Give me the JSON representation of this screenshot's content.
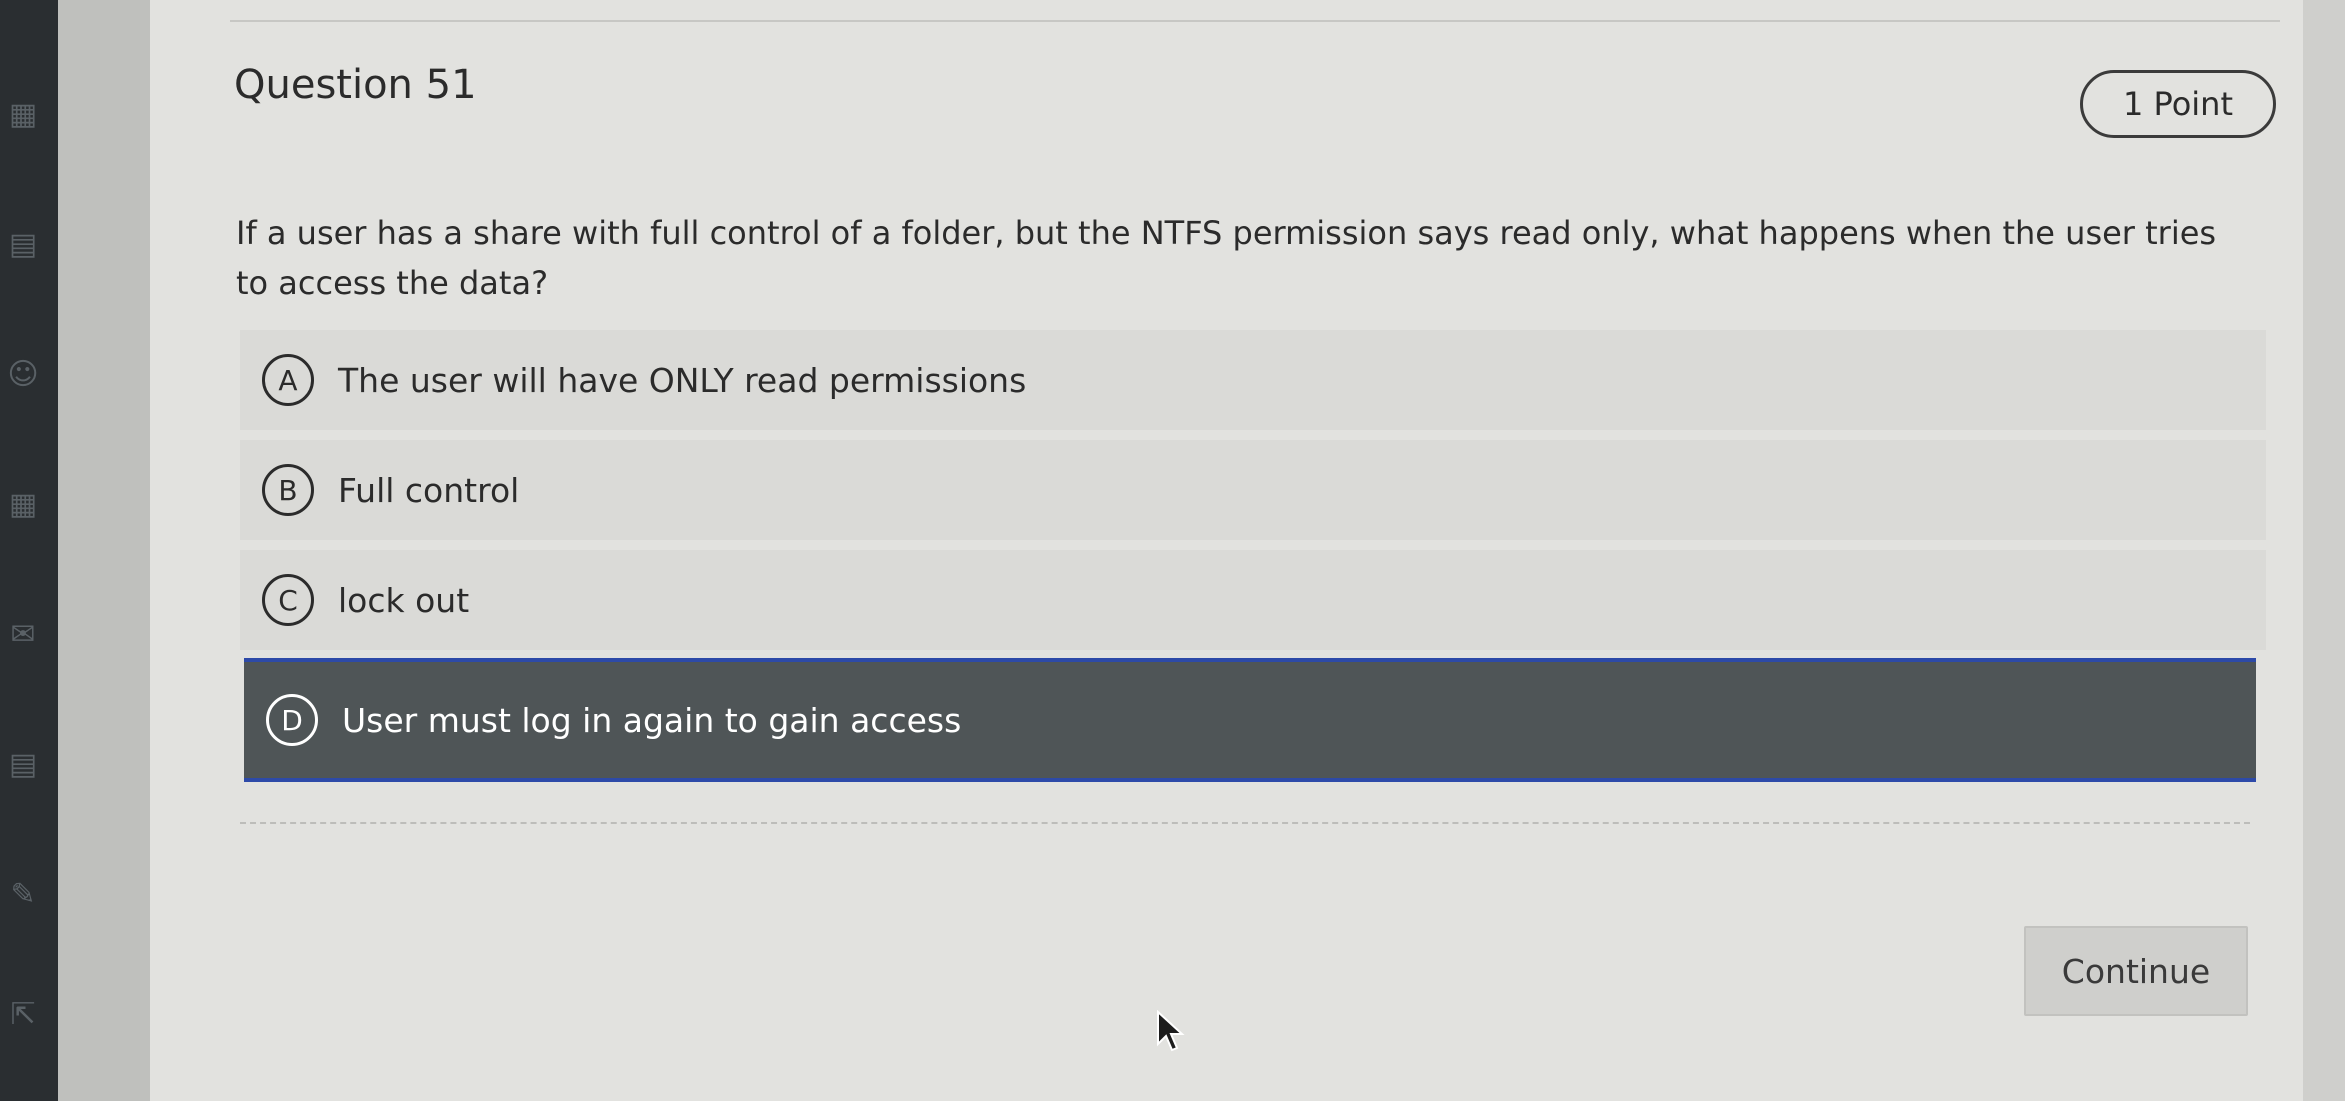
{
  "question": {
    "title": "Question 51",
    "points": "1 Point",
    "text": "If a user has a share with full control of a folder, but the NTFS permission says read only, what happens when the user tries to access the data?"
  },
  "options": [
    {
      "letter": "A",
      "label": "The user will have ONLY read permissions",
      "selected": false
    },
    {
      "letter": "B",
      "label": "Full control",
      "selected": false
    },
    {
      "letter": "C",
      "label": "lock out",
      "selected": false
    },
    {
      "letter": "D",
      "label": "User must log in again to gain access",
      "selected": true
    }
  ],
  "footer": {
    "continue_label": "Continue"
  },
  "colors": {
    "selected_background": "#4f5557",
    "selected_border": "#2d4aa8",
    "option_background": "#dadad7"
  },
  "icons": [
    "pointer-cursor-icon"
  ]
}
